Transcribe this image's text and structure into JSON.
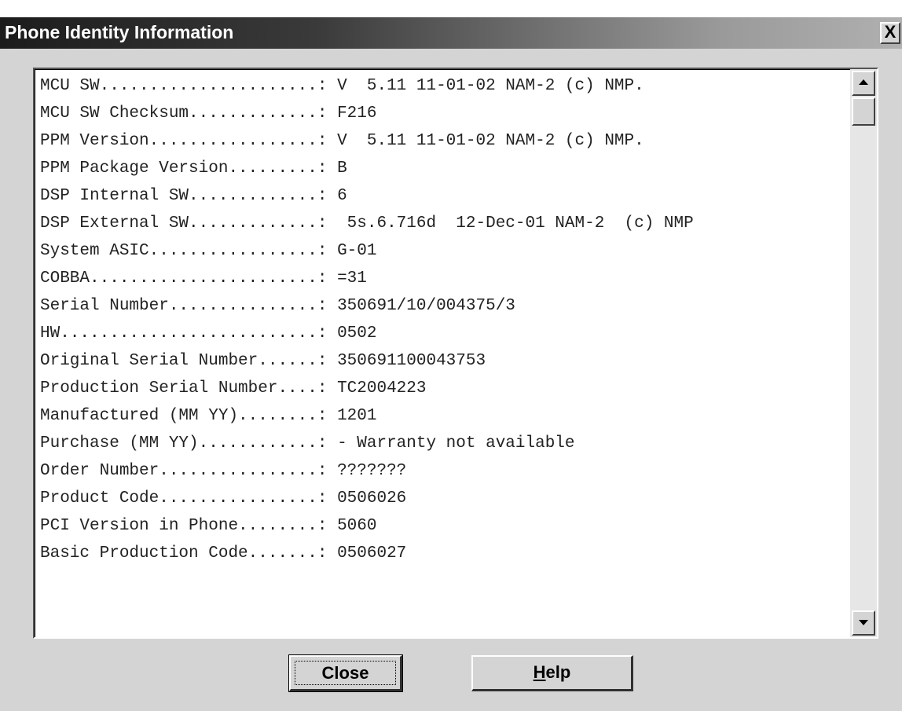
{
  "window": {
    "title": "Phone Identity Information",
    "close_glyph": "X"
  },
  "info_lines": [
    {
      "label": "MCU SW......................: ",
      "value": "V  5.11 11-01-02 NAM-2 (c) NMP."
    },
    {
      "label": "MCU SW Checksum.............: ",
      "value": "F216"
    },
    {
      "label": "PPM Version.................: ",
      "value": "V  5.11 11-01-02 NAM-2 (c) NMP."
    },
    {
      "label": "PPM Package Version.........: ",
      "value": "B"
    },
    {
      "label": "DSP Internal SW.............: ",
      "value": "6"
    },
    {
      "label": "DSP External SW.............: ",
      "value": " 5s.6.716d  12-Dec-01 NAM-2  (c) NMP"
    },
    {
      "label": "System ASIC.................: ",
      "value": "G-01"
    },
    {
      "label": "COBBA.......................: ",
      "value": "=31"
    },
    {
      "label": "Serial Number...............: ",
      "value": "350691/10/004375/3"
    },
    {
      "label": "HW..........................: ",
      "value": "0502"
    },
    {
      "label": "Original Serial Number......: ",
      "value": "350691100043753"
    },
    {
      "label": "Production Serial Number....: ",
      "value": "TC2004223"
    },
    {
      "label": "Manufactured (MM YY)........: ",
      "value": "1201"
    },
    {
      "label": "Purchase (MM YY)............: ",
      "value": "- Warranty not available"
    },
    {
      "label": "Order Number................: ",
      "value": "???????"
    },
    {
      "label": "Product Code................: ",
      "value": "0506026"
    },
    {
      "label": "PCI Version in Phone........: ",
      "value": "5060"
    },
    {
      "label": "Basic Production Code.......: ",
      "value": "0506027"
    }
  ],
  "buttons": {
    "close_label": "Close",
    "help_label_mnemonic": "H",
    "help_label_rest": "elp"
  },
  "icons": {
    "scroll_up": "arrow-up-icon",
    "scroll_down": "arrow-down-icon"
  }
}
